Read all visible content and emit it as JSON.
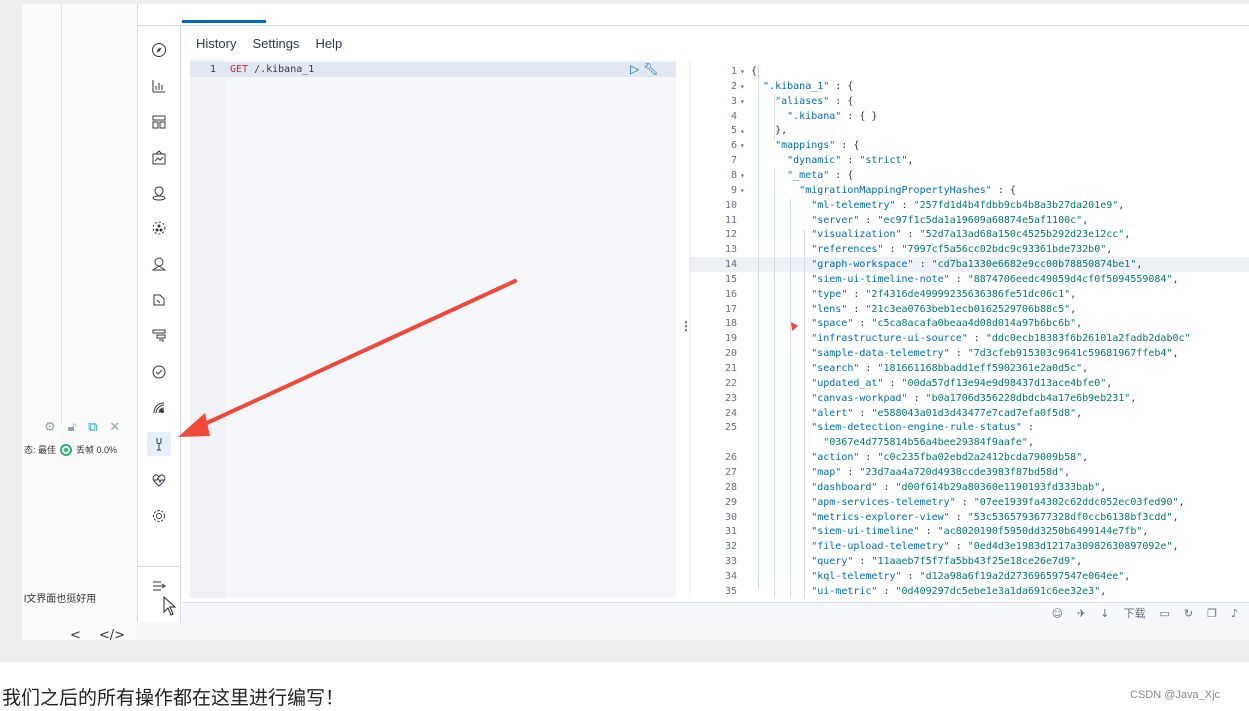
{
  "menu": {
    "history": "History",
    "settings": "Settings",
    "help": "Help"
  },
  "editor": {
    "line_no": "1",
    "method": "GET",
    "path": " /.kibana_1"
  },
  "output": [
    {
      "n": "1",
      "f": "▾",
      "t": [
        [
          "p",
          "{"
        ]
      ]
    },
    {
      "n": "2",
      "f": "▾",
      "t": [
        [
          "p",
          "  "
        ],
        [
          "k",
          "\".kibana_1\""
        ],
        [
          "p",
          " : {"
        ]
      ]
    },
    {
      "n": "3",
      "f": "▾",
      "t": [
        [
          "p",
          "    "
        ],
        [
          "k",
          "\"aliases\""
        ],
        [
          "p",
          " : {"
        ]
      ]
    },
    {
      "n": "4",
      "f": "",
      "t": [
        [
          "p",
          "      "
        ],
        [
          "k",
          "\".kibana\""
        ],
        [
          "p",
          " : { }"
        ]
      ]
    },
    {
      "n": "5",
      "f": "▴",
      "t": [
        [
          "p",
          "    },"
        ]
      ]
    },
    {
      "n": "6",
      "f": "▾",
      "t": [
        [
          "p",
          "    "
        ],
        [
          "k",
          "\"mappings\""
        ],
        [
          "p",
          " : {"
        ]
      ]
    },
    {
      "n": "7",
      "f": "",
      "t": [
        [
          "p",
          "      "
        ],
        [
          "k",
          "\"dynamic\""
        ],
        [
          "p",
          " : "
        ],
        [
          "s",
          "\"strict\""
        ],
        [
          "p",
          ","
        ]
      ]
    },
    {
      "n": "8",
      "f": "▾",
      "t": [
        [
          "p",
          "      "
        ],
        [
          "k",
          "\"_meta\""
        ],
        [
          "p",
          " : {"
        ]
      ]
    },
    {
      "n": "9",
      "f": "▾",
      "t": [
        [
          "p",
          "        "
        ],
        [
          "k",
          "\"migrationMappingPropertyHashes\""
        ],
        [
          "p",
          " : {"
        ]
      ]
    },
    {
      "n": "10",
      "f": "",
      "t": [
        [
          "p",
          "          "
        ],
        [
          "k",
          "\"ml-telemetry\""
        ],
        [
          "p",
          " : "
        ],
        [
          "s",
          "\"257fd1d4b4fdbb9cb4b8a3b27da201e9\""
        ],
        [
          "p",
          ","
        ]
      ]
    },
    {
      "n": "11",
      "f": "",
      "t": [
        [
          "p",
          "          "
        ],
        [
          "k",
          "\"server\""
        ],
        [
          "p",
          " : "
        ],
        [
          "s",
          "\"ec97f1c5da1a19609a60874e5af1100c\""
        ],
        [
          "p",
          ","
        ]
      ]
    },
    {
      "n": "12",
      "f": "",
      "t": [
        [
          "p",
          "          "
        ],
        [
          "k",
          "\"visualization\""
        ],
        [
          "p",
          " : "
        ],
        [
          "s",
          "\"52d7a13ad68a150c4525b292d23e12cc\""
        ],
        [
          "p",
          ","
        ]
      ]
    },
    {
      "n": "13",
      "f": "",
      "t": [
        [
          "p",
          "          "
        ],
        [
          "k",
          "\"references\""
        ],
        [
          "p",
          " : "
        ],
        [
          "s",
          "\"7997cf5a56cc02bdc9c93361bde732b0\""
        ],
        [
          "p",
          ","
        ]
      ]
    },
    {
      "n": "14",
      "f": "",
      "hl": true,
      "t": [
        [
          "p",
          "          "
        ],
        [
          "k",
          "\"graph-workspace\""
        ],
        [
          "p",
          " : "
        ],
        [
          "s",
          "\"cd7ba1330e6682e9cc00b78850874be1\""
        ],
        [
          "p",
          ","
        ]
      ]
    },
    {
      "n": "15",
      "f": "",
      "t": [
        [
          "p",
          "          "
        ],
        [
          "k",
          "\"siem-ui-timeline-note\""
        ],
        [
          "p",
          " : "
        ],
        [
          "s",
          "\"8874706eedc49059d4cf0f5094559084\""
        ],
        [
          "p",
          ","
        ]
      ]
    },
    {
      "n": "16",
      "f": "",
      "t": [
        [
          "p",
          "          "
        ],
        [
          "k",
          "\"type\""
        ],
        [
          "p",
          " : "
        ],
        [
          "s",
          "\"2f4316de49999235636386fe51dc06c1\""
        ],
        [
          "p",
          ","
        ]
      ]
    },
    {
      "n": "17",
      "f": "",
      "t": [
        [
          "p",
          "          "
        ],
        [
          "k",
          "\"lens\""
        ],
        [
          "p",
          " : "
        ],
        [
          "s",
          "\"21c3ea0763beb1ecb0162529706b88c5\""
        ],
        [
          "p",
          ","
        ]
      ]
    },
    {
      "n": "18",
      "f": "",
      "t": [
        [
          "p",
          "          "
        ],
        [
          "k",
          "\"space\""
        ],
        [
          "p",
          " : "
        ],
        [
          "s",
          "\"c5ca8acafa0beaa4d08d014a97b6bc6b\""
        ],
        [
          "p",
          ","
        ]
      ]
    },
    {
      "n": "19",
      "f": "",
      "t": [
        [
          "p",
          "          "
        ],
        [
          "k",
          "\"infrastructure-ui-source\""
        ],
        [
          "p",
          " : "
        ],
        [
          "s",
          "\"ddc0ecb18383f6b26101a2fadb2dab0c\""
        ]
      ]
    },
    {
      "n": "20",
      "f": "",
      "t": [
        [
          "p",
          "          "
        ],
        [
          "k",
          "\"sample-data-telemetry\""
        ],
        [
          "p",
          " : "
        ],
        [
          "s",
          "\"7d3cfeb915303c9641c59681967ffeb4\""
        ],
        [
          "p",
          ","
        ]
      ]
    },
    {
      "n": "21",
      "f": "",
      "t": [
        [
          "p",
          "          "
        ],
        [
          "k",
          "\"search\""
        ],
        [
          "p",
          " : "
        ],
        [
          "s",
          "\"181661168bbadd1eff5902361e2a0d5c\""
        ],
        [
          "p",
          ","
        ]
      ]
    },
    {
      "n": "22",
      "f": "",
      "t": [
        [
          "p",
          "          "
        ],
        [
          "k",
          "\"updated_at\""
        ],
        [
          "p",
          " : "
        ],
        [
          "s",
          "\"00da57df13e94e9d98437d13ace4bfe0\""
        ],
        [
          "p",
          ","
        ]
      ]
    },
    {
      "n": "23",
      "f": "",
      "t": [
        [
          "p",
          "          "
        ],
        [
          "k",
          "\"canvas-workpad\""
        ],
        [
          "p",
          " : "
        ],
        [
          "s",
          "\"b0a1706d356228dbdcb4a17e6b9eb231\""
        ],
        [
          "p",
          ","
        ]
      ]
    },
    {
      "n": "24",
      "f": "",
      "t": [
        [
          "p",
          "          "
        ],
        [
          "k",
          "\"alert\""
        ],
        [
          "p",
          " : "
        ],
        [
          "s",
          "\"e588043a01d3d43477e7cad7efa0f5d8\""
        ],
        [
          "p",
          ","
        ]
      ]
    },
    {
      "n": "25",
      "f": "",
      "t": [
        [
          "p",
          "          "
        ],
        [
          "k",
          "\"siem-detection-engine-rule-status\""
        ],
        [
          "p",
          " :"
        ]
      ]
    },
    {
      "n": "",
      "f": "",
      "t": [
        [
          "p",
          "            "
        ],
        [
          "s",
          "\"0367e4d775814b56a4bee29384f9aafe\""
        ],
        [
          "p",
          ","
        ]
      ]
    },
    {
      "n": "26",
      "f": "",
      "t": [
        [
          "p",
          "          "
        ],
        [
          "k",
          "\"action\""
        ],
        [
          "p",
          " : "
        ],
        [
          "s",
          "\"c0c235fba02ebd2a2412bcda79009b58\""
        ],
        [
          "p",
          ","
        ]
      ]
    },
    {
      "n": "27",
      "f": "",
      "t": [
        [
          "p",
          "          "
        ],
        [
          "k",
          "\"map\""
        ],
        [
          "p",
          " : "
        ],
        [
          "s",
          "\"23d7aa4a720d4938ccde3983f87bd58d\""
        ],
        [
          "p",
          ","
        ]
      ]
    },
    {
      "n": "28",
      "f": "",
      "t": [
        [
          "p",
          "          "
        ],
        [
          "k",
          "\"dashboard\""
        ],
        [
          "p",
          " : "
        ],
        [
          "s",
          "\"d00f614b29a80360e1190193fd333bab\""
        ],
        [
          "p",
          ","
        ]
      ]
    },
    {
      "n": "29",
      "f": "",
      "t": [
        [
          "p",
          "          "
        ],
        [
          "k",
          "\"apm-services-telemetry\""
        ],
        [
          "p",
          " : "
        ],
        [
          "s",
          "\"07ee1939fa4302c62ddc052ec03fed90\""
        ],
        [
          "p",
          ","
        ]
      ]
    },
    {
      "n": "30",
      "f": "",
      "t": [
        [
          "p",
          "          "
        ],
        [
          "k",
          "\"metrics-explorer-view\""
        ],
        [
          "p",
          " : "
        ],
        [
          "s",
          "\"53c5365793677328df0ccb6138bf3cdd\""
        ],
        [
          "p",
          ","
        ]
      ]
    },
    {
      "n": "31",
      "f": "",
      "t": [
        [
          "p",
          "          "
        ],
        [
          "k",
          "\"siem-ui-timeline\""
        ],
        [
          "p",
          " : "
        ],
        [
          "s",
          "\"ac8020190f5950dd3250b6499144e7fb\""
        ],
        [
          "p",
          ","
        ]
      ]
    },
    {
      "n": "32",
      "f": "",
      "t": [
        [
          "p",
          "          "
        ],
        [
          "k",
          "\"file-upload-telemetry\""
        ],
        [
          "p",
          " : "
        ],
        [
          "s",
          "\"0ed4d3e1983d1217a30982630897092e\""
        ],
        [
          "p",
          ","
        ]
      ]
    },
    {
      "n": "33",
      "f": "",
      "t": [
        [
          "p",
          "          "
        ],
        [
          "k",
          "\"query\""
        ],
        [
          "p",
          " : "
        ],
        [
          "s",
          "\"11aaeb7f5f7fa5bb43f25e18ce26e7d9\""
        ],
        [
          "p",
          ","
        ]
      ]
    },
    {
      "n": "34",
      "f": "",
      "t": [
        [
          "p",
          "          "
        ],
        [
          "k",
          "\"kql-telemetry\""
        ],
        [
          "p",
          " : "
        ],
        [
          "s",
          "\"d12a98a6f19a2d273696597547e064ee\""
        ],
        [
          "p",
          ","
        ]
      ]
    },
    {
      "n": "35",
      "f": "",
      "t": [
        [
          "p",
          "          "
        ],
        [
          "k",
          "\"ui-metric\""
        ],
        [
          "p",
          " : "
        ],
        [
          "s",
          "\"0d409297dc5ebe1e3a1da691c6ee32e3\""
        ],
        [
          "p",
          ","
        ]
      ]
    }
  ],
  "sidebar": [
    {
      "icon": "compass-icon"
    },
    {
      "icon": "visualize-icon"
    },
    {
      "icon": "dashboard-icon"
    },
    {
      "icon": "canvas-icon"
    },
    {
      "icon": "maps-icon"
    },
    {
      "icon": "ml-icon"
    },
    {
      "icon": "infrastructure-icon"
    },
    {
      "icon": "logs-icon"
    },
    {
      "icon": "apm-icon"
    },
    {
      "icon": "uptime-icon"
    },
    {
      "icon": "siem-icon"
    },
    {
      "icon": "dev-tools-icon",
      "active": true
    },
    {
      "icon": "monitoring-icon"
    },
    {
      "icon": "management-icon"
    }
  ],
  "left_panel": {
    "status_prefix": "态: 最佳",
    "status_value": "丢帧 0.0%",
    "note": "l文界面也挺好用",
    "nav_back": "<",
    "nav_code": "</>"
  },
  "statusbar": {
    "download": "下载"
  },
  "caption": "我们之后的所有操作都在这里进行编写！",
  "watermark": "CSDN @Java_Xjc",
  "colors": {
    "accent": "#006bb8",
    "annotation_arrow": "#f0483a",
    "string": "#00796b",
    "key": "#006bb8"
  }
}
